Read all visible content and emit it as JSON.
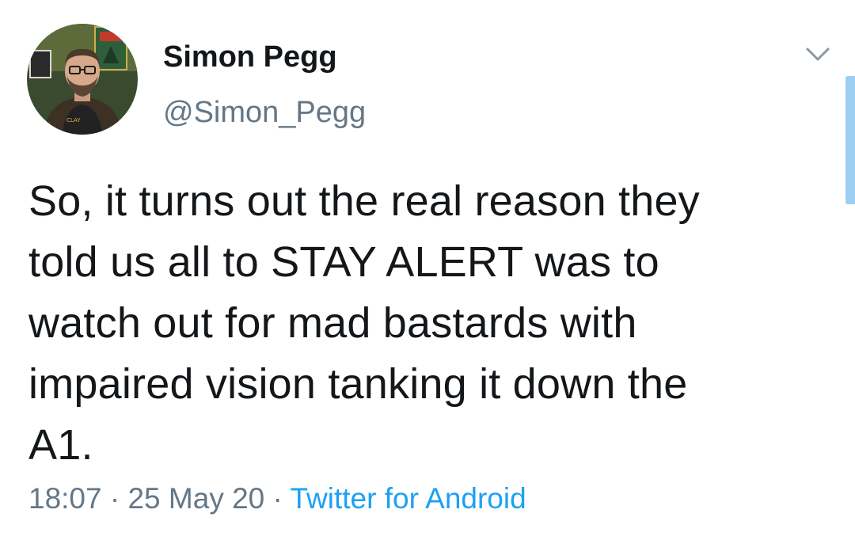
{
  "author": {
    "display_name": "Simon Pegg",
    "handle": "@Simon_Pegg"
  },
  "tweet": {
    "text_lines": [
      "So, it turns out the real reason they",
      "told us all to STAY ALERT was to",
      "watch out for mad bastards with",
      "impaired vision tanking it down the",
      "A1."
    ]
  },
  "meta": {
    "time": "18:07",
    "separator": " · ",
    "date": "25 May 20",
    "source": "Twitter for Android"
  },
  "icons": {
    "menu": "chevron-down-icon",
    "avatar": "profile-photo"
  },
  "colors": {
    "text": "#14171a",
    "secondary": "#657786",
    "link": "#1da1f2"
  }
}
